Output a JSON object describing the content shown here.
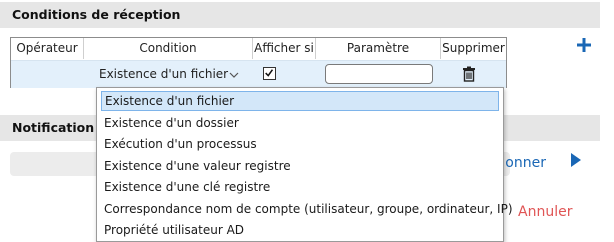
{
  "reception": {
    "title": "Conditions de réception",
    "columns": [
      "Opérateur",
      "Condition",
      "Afficher si",
      "Paramètre",
      "Supprimer"
    ],
    "row": {
      "condition": "Existence d'un fichier",
      "show_if_checked": true,
      "parameter": ""
    }
  },
  "dropdown": {
    "options": [
      "Existence d'un fichier",
      "Existence d'un dossier",
      "Exécution d'un processus",
      "Existence d'une valeur registre",
      "Existence d'une clé registre",
      "Correspondance nom de compte (utilisateur, groupe, ordinateur, IP)",
      "Propriété utilisateur AD"
    ],
    "selected_index": 0
  },
  "notification": {
    "title": "Notification S",
    "select_label": "ionner"
  },
  "footer": {
    "cancel_label": "Annuler"
  },
  "colors": {
    "accent": "#1a67b5",
    "cancel": "#e05555",
    "row_highlight": "#e3f0fb",
    "option_selected": "#d3e7f9"
  },
  "icons": [
    "chevron-down-icon",
    "check-icon",
    "trash-icon",
    "plus-icon",
    "play-icon"
  ]
}
